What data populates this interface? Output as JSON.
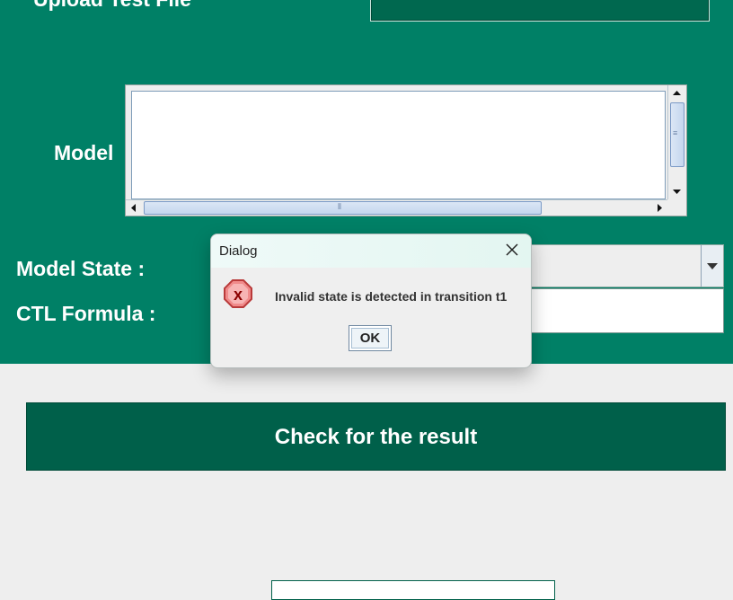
{
  "form": {
    "upload_label": "Upload Test File",
    "model_label": "Model",
    "state_label": "Model State :",
    "ctl_label": "CTL Formula :",
    "check_button": "Check for the result"
  },
  "dialog": {
    "title": "Dialog",
    "message": "Invalid state is detected in transition t1",
    "ok_label": "OK",
    "icon": "error-icon",
    "icon_text": "x"
  },
  "colors": {
    "panel": "#008066",
    "button": "#00604a",
    "background": "#eeeeee"
  }
}
